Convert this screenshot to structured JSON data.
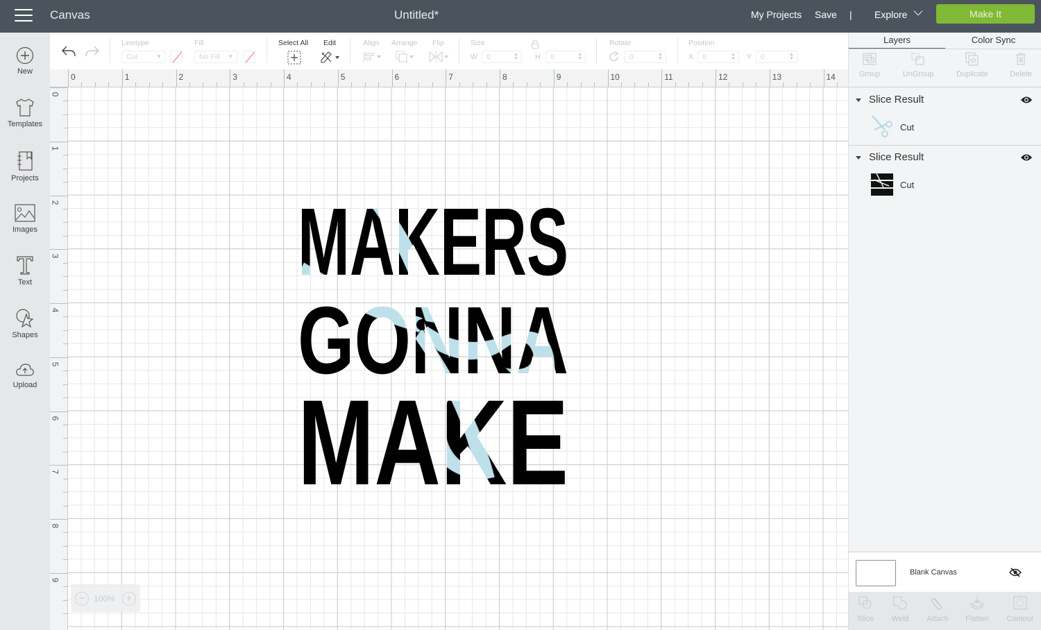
{
  "topbar": {
    "app_title": "Canvas",
    "document_title": "Untitled*",
    "my_projects": "My Projects",
    "save": "Save",
    "separator": "|",
    "explore": "Explore",
    "make_it": "Make It"
  },
  "left_nav": {
    "items": [
      {
        "label": "New",
        "icon": "plus-circle-icon"
      },
      {
        "label": "Templates",
        "icon": "tshirt-icon"
      },
      {
        "label": "Projects",
        "icon": "notebook-icon"
      },
      {
        "label": "Images",
        "icon": "image-icon"
      },
      {
        "label": "Text",
        "icon": "text-T-icon"
      },
      {
        "label": "Shapes",
        "icon": "shapes-icon"
      },
      {
        "label": "Upload",
        "icon": "cloud-upload-icon"
      }
    ]
  },
  "toolbar": {
    "linetype_label": "Linetype",
    "linetype_value": "Cut",
    "fill_label": "Fill",
    "fill_value": "No Fill",
    "select_all": "Select All",
    "edit": "Edit",
    "align": "Align",
    "arrange": "Arrange",
    "flip": "Flip",
    "size_label": "Size",
    "w_label": "W",
    "w_value": "0",
    "h_label": "H",
    "h_value": "0",
    "rotate_label": "Rotate",
    "rotate_value": "0",
    "position_label": "Position",
    "x_label": "X",
    "x_value": "0",
    "y_label": "Y",
    "y_value": "0"
  },
  "rulers": {
    "horizontal": [
      "0",
      "1",
      "2",
      "3",
      "4",
      "5",
      "6",
      "7",
      "8",
      "9",
      "10",
      "11",
      "12",
      "13",
      "14"
    ],
    "vertical": [
      "0",
      "1",
      "2",
      "3",
      "4",
      "5",
      "6",
      "7",
      "8",
      "9"
    ]
  },
  "canvas": {
    "artwork_lines": [
      "MAKERS",
      "GONNA",
      "MAKE"
    ],
    "artwork_text_color": "#000000",
    "scissors_color": "#bde0ea",
    "zoom_level": "100%"
  },
  "right_panel": {
    "tabs": [
      "Layers",
      "Color Sync"
    ],
    "actions": [
      "Group",
      "UnGroup",
      "Duplicate",
      "Delete"
    ],
    "layers": [
      {
        "title": "Slice Result",
        "child_label": "Cut",
        "thumb": "scissors-thumbnail",
        "visible": true
      },
      {
        "title": "Slice Result",
        "child_label": "Cut",
        "thumb": "makers-gonna-make-thumbnail",
        "visible": true
      }
    ],
    "blank_canvas_label": "Blank Canvas",
    "bottom_actions": [
      "Slice",
      "Weld",
      "Attach",
      "Flatten",
      "Contour"
    ]
  }
}
